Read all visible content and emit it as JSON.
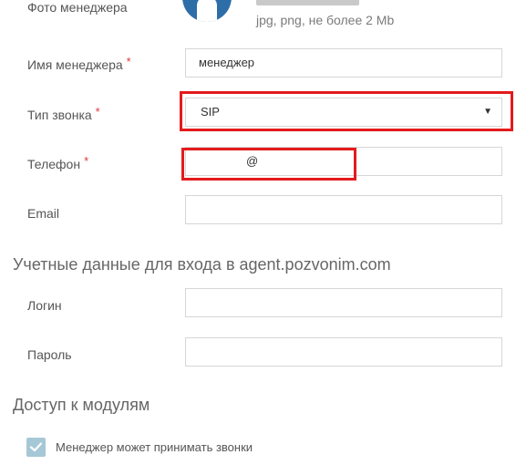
{
  "photo": {
    "label": "Фото менеджера",
    "hint": "jpg, png, не более 2 Mb"
  },
  "form": {
    "name": {
      "label": "Имя менеджера",
      "required": "*",
      "value": "менеджер"
    },
    "call_type": {
      "label": "Тип звонка",
      "required": "*",
      "selected": "SIP"
    },
    "phone": {
      "label": "Телефон",
      "required": "*",
      "value": "@"
    },
    "email": {
      "label": "Email",
      "value": ""
    }
  },
  "credentials": {
    "title": "Учетные данные для входа в agent.pozvonim.com",
    "login_label": "Логин",
    "password_label": "Пароль"
  },
  "modules": {
    "title": "Доступ к модулям",
    "can_receive_calls": {
      "label": "Менеджер может принимать звонки",
      "checked": true
    }
  },
  "colors": {
    "highlight": "#e41a1c",
    "required": "#e0383e",
    "checkbox": "#a6c8d6",
    "avatar": "#2d6ea8"
  }
}
